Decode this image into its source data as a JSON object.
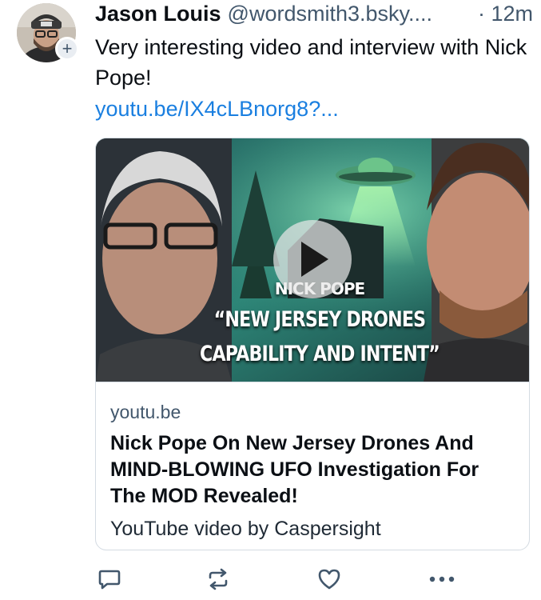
{
  "post": {
    "display_name": "Jason Louis",
    "handle": "@wordsmith3.bsky....",
    "time": "· 12m",
    "text": "Very interesting video and interview with Nick Pope!",
    "link": "youtu.be/IX4cLBnorg8?...",
    "follow_badge": "+"
  },
  "card": {
    "thumbnail": {
      "caption_line1": "NICK POPE",
      "caption_line2": "“NEW JERSEY DRONES",
      "caption_line3": "CAPABILITY AND INTENT”"
    },
    "domain": "youtu.be",
    "title": "Nick Pope On New Jersey Drones And MIND-BLOWING UFO Investigation For The MOD Revealed!",
    "description": "YouTube video by Caspersight"
  },
  "icons": {
    "reply": "speech-bubble-icon",
    "repost": "repost-arrows-icon",
    "like": "heart-icon",
    "more": "ellipsis-icon",
    "play": "play-icon"
  },
  "colors": {
    "link": "#1a7fe0",
    "muted": "#42576c",
    "text": "#0b0f14",
    "border": "#d4dbe2"
  }
}
